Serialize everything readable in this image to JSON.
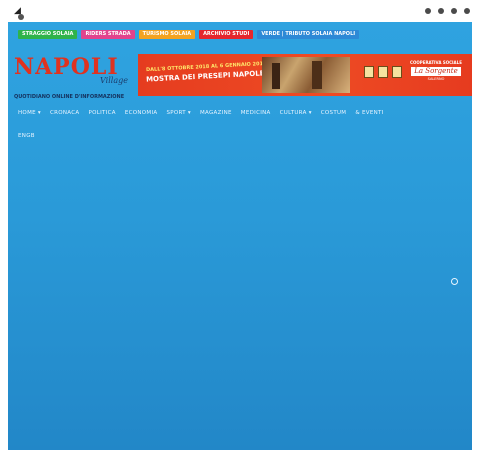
{
  "top_tags": [
    {
      "label": "STRAGGIO SOLAIA",
      "color": "#2fb34a"
    },
    {
      "label": "RIDERS STRADA",
      "color": "#e2438d"
    },
    {
      "label": "TURISMO SOLAIA",
      "color": "#f3a321"
    },
    {
      "label": "ARCHIVIO STUDI",
      "color": "#e5262d"
    },
    {
      "label": "VERDE | TRIBUTO SOLAIA NAPOLI",
      "color": "#2d89d6"
    }
  ],
  "logo": {
    "title": "NAPOLI",
    "subtitle": "Village",
    "tagline": "QUOTIDIANO ONLINE D'INFORMAZIONE"
  },
  "banner": {
    "line1": "DALL'8 OTTOBRE 2018 AL 6 GENNAIO 2019",
    "line2": "MOSTRA DEI PRESEPI NAPOLETANI",
    "ad_top": "COOPERATIVA SOCIALE",
    "ad_brand": "La Sorgente",
    "ad_bottom": "SALERNO"
  },
  "nav": [
    "HOME ▾",
    "CRONACA",
    "POLITICA",
    "ECONOMIA",
    "SPORT ▾",
    "MAGAZINE",
    "MEDICINA",
    "CULTURA ▾",
    "COSTUM",
    "& EVENTI",
    "ENGB"
  ],
  "icons": {
    "scroll_top": "circle-icon",
    "social": [
      "facebook-icon",
      "twitter-icon",
      "instagram-icon",
      "youtube-icon"
    ]
  }
}
